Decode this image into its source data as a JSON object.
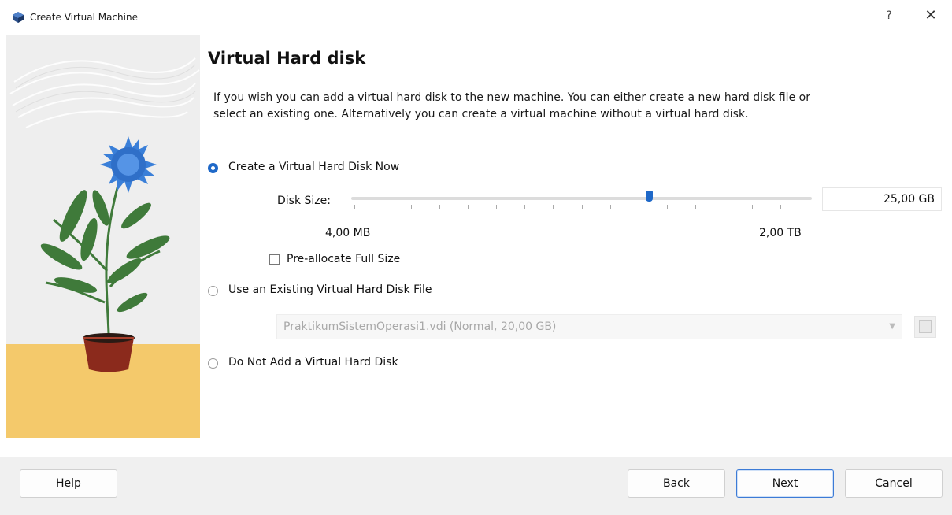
{
  "window": {
    "title": "Create Virtual Machine",
    "help_glyph": "?",
    "close_glyph": "✕",
    "icon": "virtualbox-icon"
  },
  "page": {
    "heading": "Virtual Hard disk",
    "description": "If you wish you can add a virtual hard disk to the new machine. You can either create a new hard disk file or select an existing one. Alternatively you can create a virtual machine without a virtual hard disk."
  },
  "options": {
    "create_now": {
      "label": "Create a Virtual Hard Disk Now",
      "selected": true
    },
    "use_existing": {
      "label": "Use an Existing Virtual Hard Disk File",
      "selected": false
    },
    "do_not_add": {
      "label": "Do Not Add a Virtual Hard Disk",
      "selected": false
    }
  },
  "disk": {
    "size_label": "Disk Size:",
    "size_value": "25,00 GB",
    "min_label": "4,00 MB",
    "max_label": "2,00 TB",
    "slider_fraction": 0.65,
    "preallocate_label": "Pre-allocate Full Size",
    "preallocate_checked": false
  },
  "existing": {
    "selected_file": "PraktikumSistemOperasi1.vdi (Normal, 20,00 GB)"
  },
  "buttons": {
    "help": "Help",
    "back": "Back",
    "next": "Next",
    "cancel": "Cancel"
  },
  "colors": {
    "accent": "#1e68c8",
    "footer_bg": "#f0f0f0",
    "illus_floor": "#f4c96b"
  }
}
